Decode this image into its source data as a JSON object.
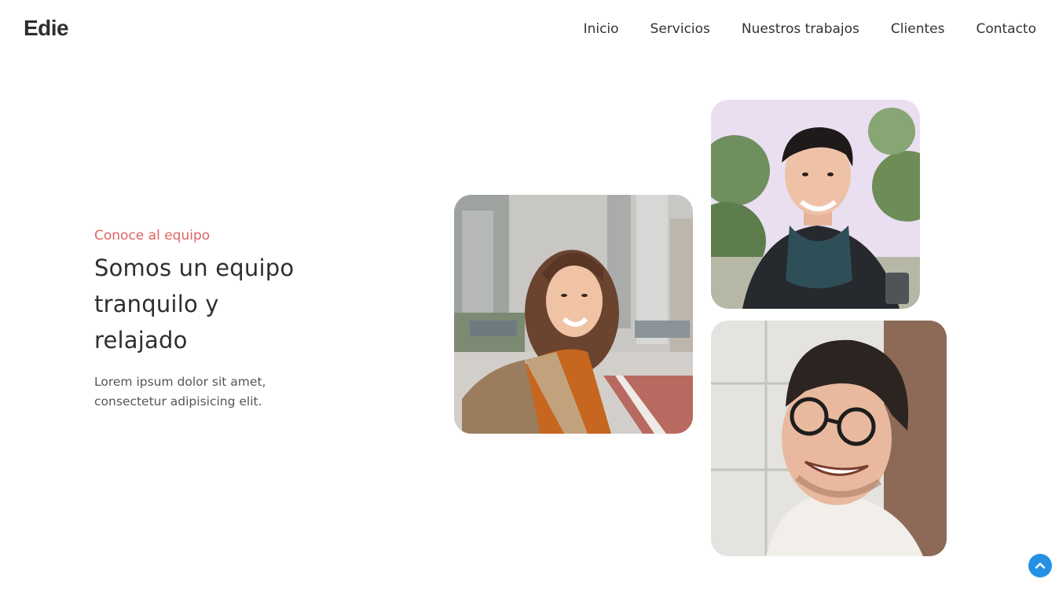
{
  "header": {
    "logo": "Edie",
    "nav": [
      "Inicio",
      "Servicios",
      "Nuestros trabajos",
      "Clientes",
      "Contacto"
    ]
  },
  "hero": {
    "kicker": "Conoce al equipo",
    "headline_lines": [
      "Somos un equipo",
      "tranquilo y",
      "relajado"
    ],
    "description_lines": [
      "Lorem ipsum dolor sit amet,",
      "consectetur adipisicing elit."
    ]
  },
  "photos": {
    "woman": "team-photo-woman",
    "man_scarf": "team-photo-man-scarf",
    "man_glasses": "team-photo-man-glasses"
  },
  "back_to_top_icon": "chevron-up-icon",
  "colors": {
    "accent": "#e06464",
    "button": "#2490e3",
    "text": "#2f2f2f"
  }
}
